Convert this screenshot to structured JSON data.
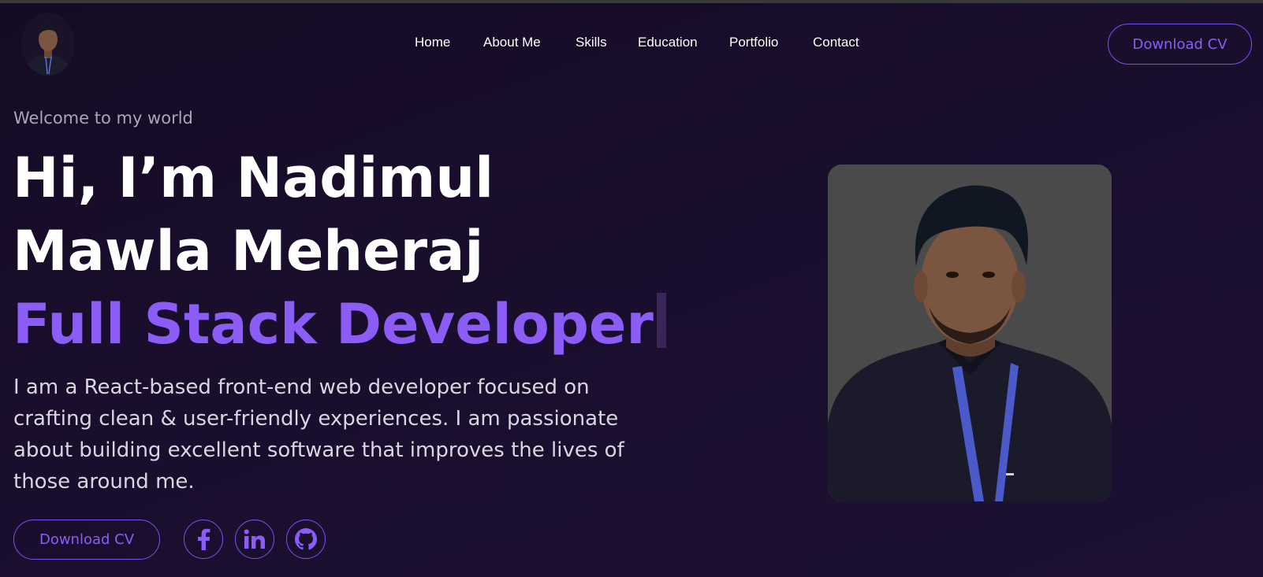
{
  "nav": {
    "items": [
      "Home",
      "About Me",
      "Skills",
      "Education",
      "Portfolio",
      "Contact"
    ]
  },
  "header": {
    "download_cv": "Download CV"
  },
  "hero": {
    "welcome": "Welcome to my world",
    "greeting_line1": "Hi, I’m Nadimul",
    "greeting_line2": "Mawla Meheraj",
    "role": "Full Stack Developer",
    "description": "I am a React-based front-end web developer focused on crafting clean & user-friendly experiences. I am passionate about building excellent software that improves the lives of those around me.",
    "download_cv": "Download CV"
  },
  "social": {
    "icons": [
      "facebook-icon",
      "linkedin-icon",
      "github-icon"
    ]
  },
  "colors": {
    "accent": "#8b5cf6",
    "background": "#1a0e2d",
    "photo_bg": "#4a4a4a"
  }
}
